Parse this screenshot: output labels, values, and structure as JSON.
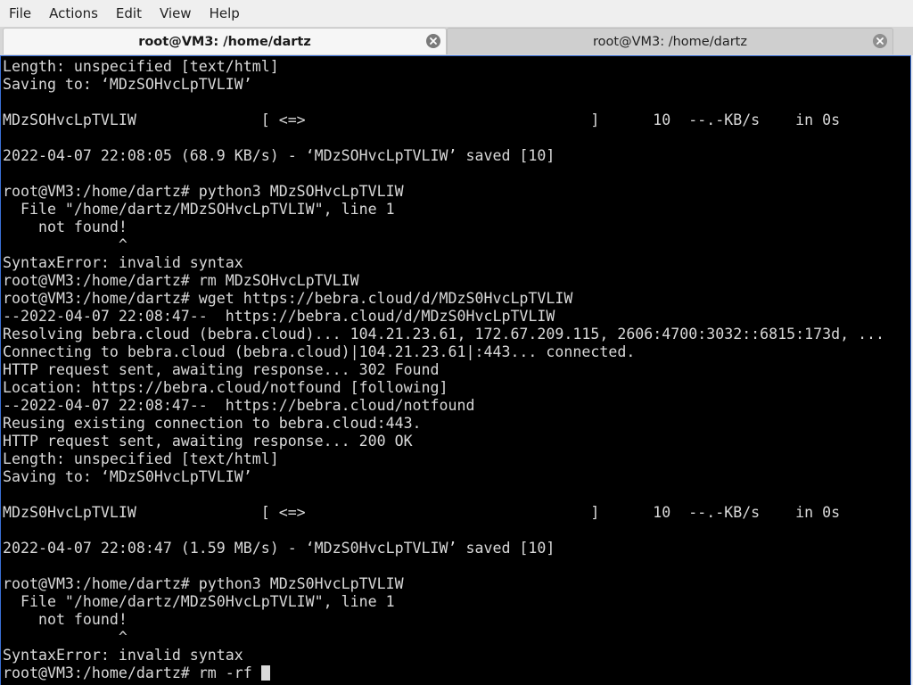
{
  "menu": [
    "File",
    "Actions",
    "Edit",
    "View",
    "Help"
  ],
  "tabs": [
    {
      "title": "root@VM3: /home/dartz",
      "active": true
    },
    {
      "title": "root@VM3: /home/dartz",
      "active": false
    }
  ],
  "terminal": {
    "lines": [
      "Length: unspecified [text/html]",
      "Saving to: ‘MDzSOHvcLpTVLIW’",
      "",
      "MDzSOHvcLpTVLIW              [ <=>                                ]      10  --.-KB/s    in 0s",
      "",
      "2022-04-07 22:08:05 (68.9 KB/s) - ‘MDzSOHvcLpTVLIW’ saved [10]",
      "",
      "root@VM3:/home/dartz# python3 MDzSOHvcLpTVLIW",
      "  File \"/home/dartz/MDzSOHvcLpTVLIW\", line 1",
      "    not found!",
      "             ^",
      "SyntaxError: invalid syntax",
      "root@VM3:/home/dartz# rm MDzSOHvcLpTVLIW",
      "root@VM3:/home/dartz# wget https://bebra.cloud/d/MDzS0HvcLpTVLIW",
      "--2022-04-07 22:08:47--  https://bebra.cloud/d/MDzS0HvcLpTVLIW",
      "Resolving bebra.cloud (bebra.cloud)... 104.21.23.61, 172.67.209.115, 2606:4700:3032::6815:173d, ...",
      "Connecting to bebra.cloud (bebra.cloud)|104.21.23.61|:443... connected.",
      "HTTP request sent, awaiting response... 302 Found",
      "Location: https://bebra.cloud/notfound [following]",
      "--2022-04-07 22:08:47--  https://bebra.cloud/notfound",
      "Reusing existing connection to bebra.cloud:443.",
      "HTTP request sent, awaiting response... 200 OK",
      "Length: unspecified [text/html]",
      "Saving to: ‘MDzS0HvcLpTVLIW’",
      "",
      "MDzS0HvcLpTVLIW              [ <=>                                ]      10  --.-KB/s    in 0s",
      "",
      "2022-04-07 22:08:47 (1.59 MB/s) - ‘MDzS0HvcLpTVLIW’ saved [10]",
      "",
      "root@VM3:/home/dartz# python3 MDzS0HvcLpTVLIW",
      "  File \"/home/dartz/MDzS0HvcLpTVLIW\", line 1",
      "    not found!",
      "             ^",
      "SyntaxError: invalid syntax"
    ],
    "prompt_line": "root@VM3:/home/dartz# rm -rf "
  },
  "colors": {
    "terminal_bg": "#000000",
    "terminal_fg": "#d9d9d9",
    "focus_border": "#3a6fd4"
  },
  "icons": {
    "tab_close": "close-circle-icon"
  }
}
